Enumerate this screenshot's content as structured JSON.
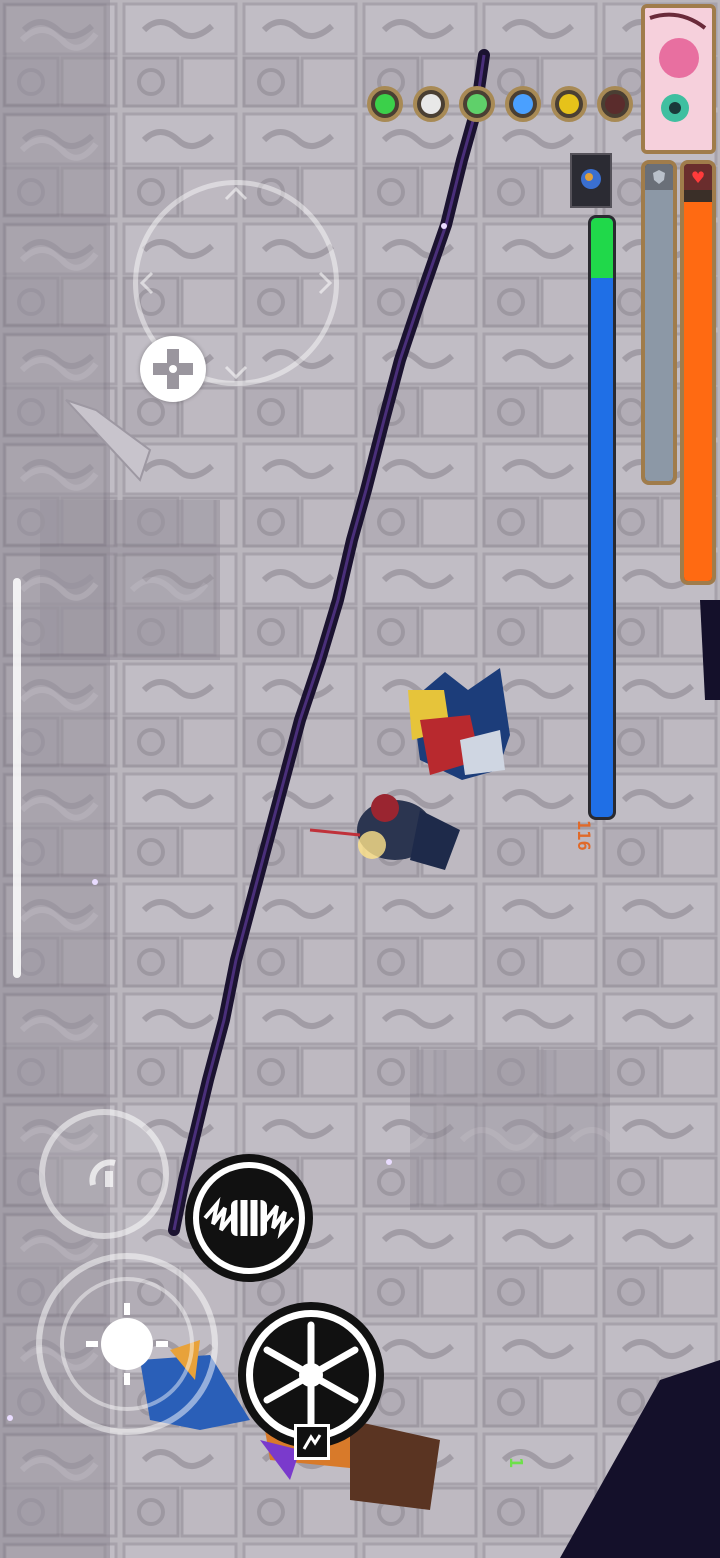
{
  "hud": {
    "energy_value": "116",
    "coins": "1",
    "health_fill": 0.97,
    "shield_fill": 1.0,
    "energy_fill": 1.0
  },
  "buff_icons": [
    {
      "name": "green-orb-icon",
      "color": "#3bd04a"
    },
    {
      "name": "white-bag-icon",
      "color": "#e8e8e8"
    },
    {
      "name": "swirl-orb-icon",
      "color": "#5fd06a"
    },
    {
      "name": "star-wand-icon",
      "color": "#4aa0ff"
    },
    {
      "name": "gold-coin-icon",
      "color": "#e6c21a"
    },
    {
      "name": "dark-bomb-icon",
      "color": "#5a2c2c"
    }
  ],
  "colors": {
    "health": "#ff6a12",
    "shield": "#8c98a6",
    "energy": "#1f6fe6",
    "energy_top": "#20d84a",
    "wall": "#d2cfd6",
    "wall_dark": "#8a8690",
    "rift": "#1b1330"
  }
}
